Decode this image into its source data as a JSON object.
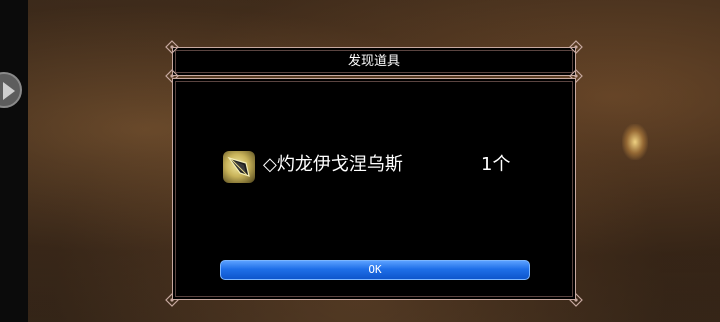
{
  "dialog": {
    "title": "发现道具",
    "item": {
      "name": "◇灼龙伊戈涅乌斯",
      "count": "1个",
      "icon": "spear-blade-icon"
    },
    "ok_label": "OK"
  },
  "colors": {
    "frame_border": "#c7a9a0",
    "button_blue": "#1f6fe8",
    "panel_bg": "#000000"
  }
}
